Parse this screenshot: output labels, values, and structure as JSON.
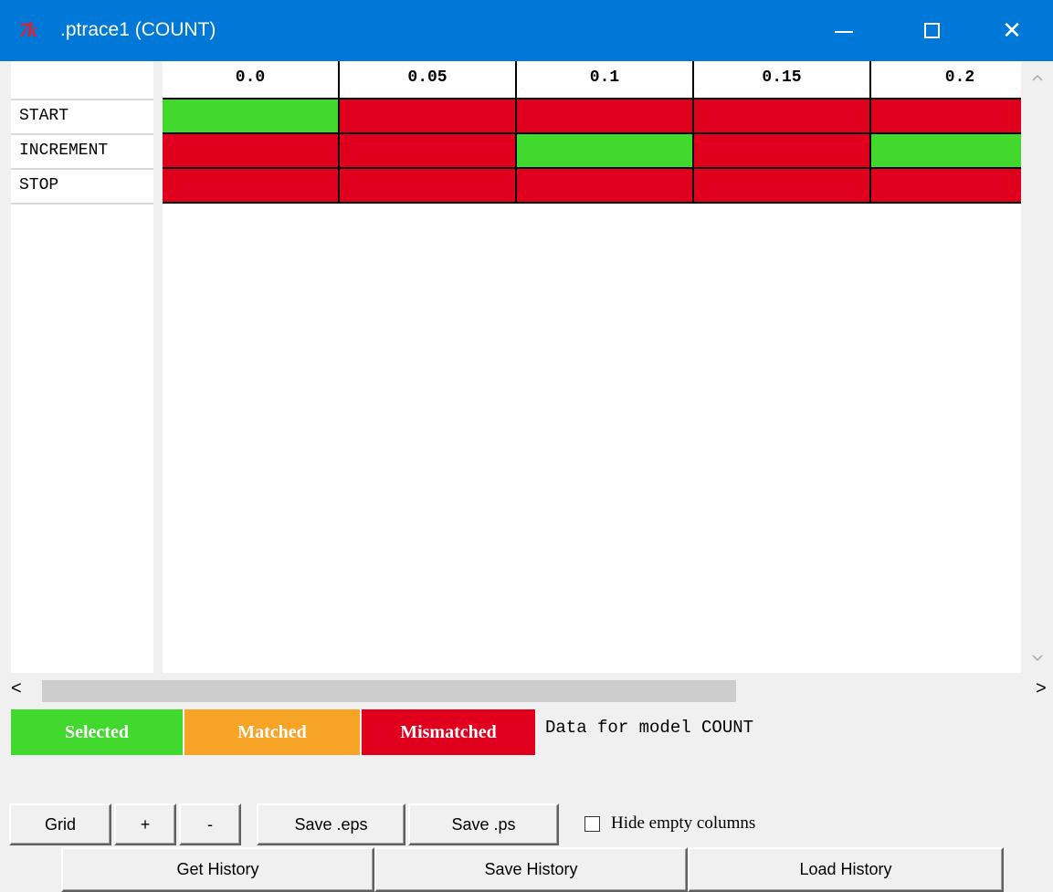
{
  "window": {
    "title": ".ptrace1 (COUNT)",
    "logo_text": "7k",
    "minimize_glyph": "—",
    "maximize_glyph": "☐",
    "close_glyph": "✕"
  },
  "grid": {
    "columns": [
      "0.0",
      "0.05",
      "0.1",
      "0.15",
      "0.2"
    ],
    "rows": [
      {
        "label": "START",
        "cells": [
          "selected",
          "mismatched",
          "mismatched",
          "mismatched",
          "mismatched"
        ]
      },
      {
        "label": "INCREMENT",
        "cells": [
          "mismatched",
          "mismatched",
          "selected",
          "mismatched",
          "selected"
        ]
      },
      {
        "label": "STOP",
        "cells": [
          "mismatched",
          "mismatched",
          "mismatched",
          "mismatched",
          "mismatched"
        ]
      }
    ]
  },
  "colors": {
    "selected": "#41d92d",
    "matched": "#f7a325",
    "mismatched": "#e0001e",
    "titlebar": "#0078d7"
  },
  "legend": {
    "selected": "Selected",
    "matched": "Matched",
    "mismatched": "Mismatched",
    "note": "Data for model COUNT"
  },
  "scrollbars": {
    "up_icon": "chevron-up-icon",
    "down_icon": "chevron-down-icon",
    "left_glyph": "<",
    "right_glyph": ">"
  },
  "toolbar": {
    "grid_label": "Grid",
    "plus_label": "+",
    "minus_label": "-",
    "save_eps_label": "Save .eps",
    "save_ps_label": "Save .ps",
    "hide_empty_label": "Hide empty columns",
    "hide_empty_checked": false
  },
  "history": {
    "get_label": "Get History",
    "save_label": "Save History",
    "load_label": "Load History"
  }
}
